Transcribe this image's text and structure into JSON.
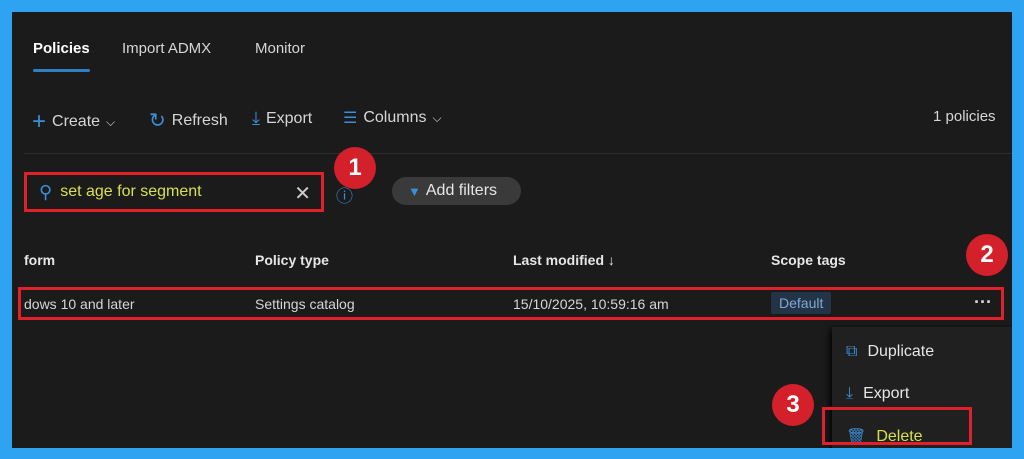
{
  "tabs": [
    {
      "label": "Policies",
      "active": true
    },
    {
      "label": "Import ADMX"
    },
    {
      "label": "Monitor"
    }
  ],
  "toolbar": {
    "create": "Create",
    "refresh": "Refresh",
    "export": "Export",
    "columns": "Columns",
    "count": "1 policies"
  },
  "search": {
    "value": "set age for segment"
  },
  "add_filters": "Add filters",
  "columns": [
    "form",
    "Policy type",
    "Last modified ↓",
    "Scope tags"
  ],
  "row": {
    "platform": "dows 10 and later",
    "policy_type": "Settings catalog",
    "last_modified": "15/10/2025, 10:59:16 am",
    "scope_tag": "Default",
    "more": "···"
  },
  "menu": {
    "duplicate": "Duplicate",
    "export": "Export",
    "delete": "Delete"
  },
  "callouts": [
    "1",
    "2",
    "3"
  ]
}
